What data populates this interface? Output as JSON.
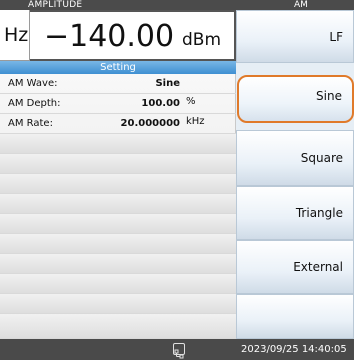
{
  "amplitude": {
    "header": "AMPLITUDE",
    "left_unit": "Hz",
    "value": "−140.00",
    "unit": "dBm"
  },
  "settings": {
    "header": "Setting",
    "rows": [
      {
        "label": "AM Wave:",
        "value": "Sine",
        "unit": ""
      },
      {
        "label": "AM Depth:",
        "value": "100.00",
        "unit": "%"
      },
      {
        "label": "AM Rate:",
        "value": "20.000000",
        "unit": "kHz"
      }
    ]
  },
  "menu": {
    "header": "AM",
    "items": [
      {
        "label": "LF",
        "selected": false
      },
      {
        "label": "Sine",
        "selected": true
      },
      {
        "label": "Square",
        "selected": false
      },
      {
        "label": "Triangle",
        "selected": false
      },
      {
        "label": "External",
        "selected": false
      },
      {
        "label": "",
        "selected": false
      }
    ]
  },
  "status": {
    "icon": "network-icon",
    "datetime": "2023/09/25 14:40:05"
  },
  "colors": {
    "accent_selected": "#e07a2a",
    "setting_header": "#4a9ad8",
    "header_bar": "#4b4b4b"
  }
}
